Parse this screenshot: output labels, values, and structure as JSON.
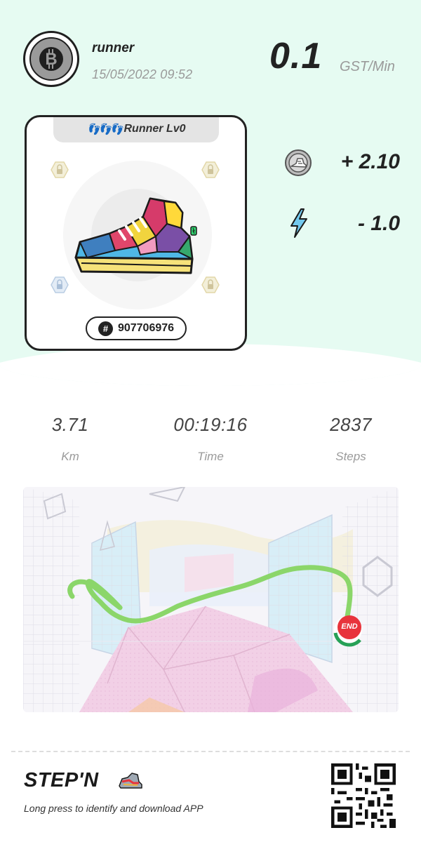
{
  "user": {
    "name": "runner",
    "date": "15/05/2022 09:52",
    "avatar_icon": "bitcoin-icon"
  },
  "rate": {
    "value": "0.1",
    "unit": "GST/Min"
  },
  "sneaker": {
    "tab_label": "Runner Lv0",
    "tab_icon": "footprints-icon",
    "id": "907706976",
    "id_icon": "hash-icon"
  },
  "gains": {
    "gst": "+ 2.10",
    "gst_icon": "gst-coin-icon",
    "energy": "- 1.0",
    "energy_icon": "lightning-icon"
  },
  "stats": [
    {
      "value": "3.71",
      "label": "Km"
    },
    {
      "value": "00:19:16",
      "label": "Time"
    },
    {
      "value": "2837",
      "label": "Steps"
    }
  ],
  "map": {
    "end_label": "END"
  },
  "footer": {
    "brand": "STEP'N",
    "tagline": "Long press to identify and download APP",
    "qr_icon": "qr-code-icon"
  },
  "colors": {
    "top_background": "#e6fbf2",
    "route": "#8bd66a",
    "end_badge": "#e8343c",
    "text_dark": "#222222",
    "text_muted": "#9a9a9a"
  }
}
